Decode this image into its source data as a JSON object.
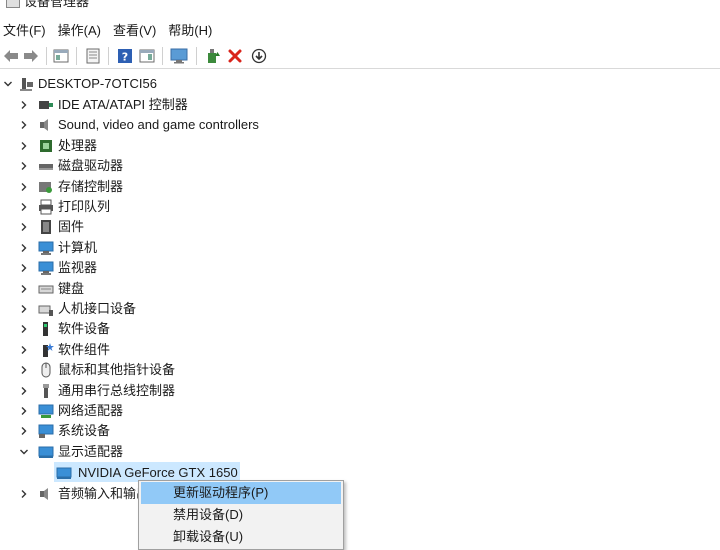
{
  "window": {
    "title": "设备管理器"
  },
  "menu": [
    {
      "label": "文件(F)"
    },
    {
      "label": "操作(A)"
    },
    {
      "label": "查看(V)"
    },
    {
      "label": "帮助(H)"
    }
  ],
  "toolbar": {
    "buttons": [
      {
        "name": "back-button",
        "icon": "arrow-left-icon"
      },
      {
        "name": "forward-button",
        "icon": "arrow-right-icon"
      },
      {
        "name": "show-hide-console-tree-button",
        "icon": "console-tree-icon"
      },
      {
        "name": "properties-button",
        "icon": "properties-icon"
      },
      {
        "name": "help-button",
        "icon": "help-icon"
      },
      {
        "name": "action-pane-button",
        "icon": "action-pane-icon"
      },
      {
        "name": "scan-hardware-button",
        "icon": "monitor-scan-icon"
      },
      {
        "name": "update-driver-button",
        "icon": "update-driver-icon"
      },
      {
        "name": "uninstall-button",
        "icon": "red-x-icon"
      },
      {
        "name": "download-button",
        "icon": "down-arrow-circle-icon"
      }
    ]
  },
  "tree": {
    "root": {
      "label": "DESKTOP-7OTCI56"
    },
    "categories": [
      {
        "label": "IDE ATA/ATAPI 控制器",
        "icon": "ide-controller-icon"
      },
      {
        "label": "Sound, video and game controllers",
        "icon": "speaker-icon"
      },
      {
        "label": "处理器",
        "icon": "cpu-icon"
      },
      {
        "label": "磁盘驱动器",
        "icon": "disk-drive-icon"
      },
      {
        "label": "存储控制器",
        "icon": "storage-controller-icon"
      },
      {
        "label": "打印队列",
        "icon": "printer-icon"
      },
      {
        "label": "固件",
        "icon": "firmware-icon"
      },
      {
        "label": "计算机",
        "icon": "computer-icon"
      },
      {
        "label": "监视器",
        "icon": "monitor-icon"
      },
      {
        "label": "键盘",
        "icon": "keyboard-icon"
      },
      {
        "label": "人机接口设备",
        "icon": "hid-icon"
      },
      {
        "label": "软件设备",
        "icon": "software-device-icon"
      },
      {
        "label": "软件组件",
        "icon": "software-component-icon"
      },
      {
        "label": "鼠标和其他指针设备",
        "icon": "mouse-icon"
      },
      {
        "label": "通用串行总线控制器",
        "icon": "usb-icon"
      },
      {
        "label": "网络适配器",
        "icon": "network-adapter-icon"
      },
      {
        "label": "系统设备",
        "icon": "system-device-icon"
      },
      {
        "label": "显示适配器",
        "icon": "display-adapter-icon",
        "expanded": true
      }
    ],
    "child": {
      "label": "NVIDIA GeForce GTX 1650"
    },
    "after": {
      "label": "音频输入和输出"
    }
  },
  "context_menu": [
    {
      "label": "更新驱动程序(P)",
      "highlighted": true
    },
    {
      "label": "禁用设备(D)"
    },
    {
      "label": "卸载设备(U)"
    }
  ]
}
